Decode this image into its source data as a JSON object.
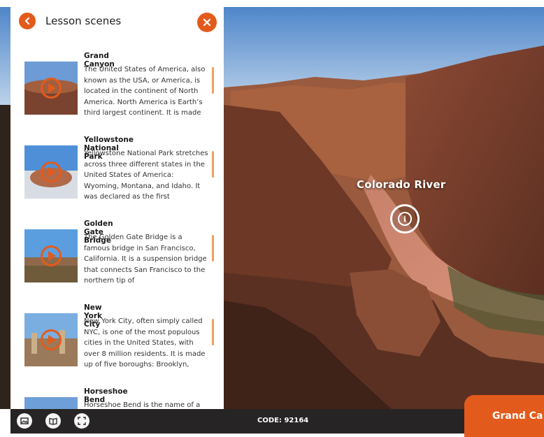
{
  "panel": {
    "title": "Lesson scenes",
    "items": [
      {
        "title": "Grand Canyon",
        "description": "The United States of America, also known as the USA, or America, is located in the continent of North America. North America is Earth’s third largest continent. It is made"
      },
      {
        "title": "Yellowstone National Park",
        "description": "Yellowstone National Park stretches across three different states in the United States of America: Wyoming, Montana, and Idaho. It was declared as the first"
      },
      {
        "title": "Golden Gate Bridge",
        "description": "The Golden Gate Bridge is a famous bridge in San Francisco, California. It is a suspension bridge that connects San Francisco to the northern tip of"
      },
      {
        "title": "New York City",
        "description": "New York City, often simply called NYC, is one of the most populous cities in the United States, with over 8 million residents. It is made up of five boroughs: Brooklyn,"
      },
      {
        "title": "Horseshoe Bend",
        "description": "Horseshoe Bend is the name of a"
      }
    ]
  },
  "hotspot": {
    "label": "Colorado River"
  },
  "bottom_bar": {
    "code": "CODE: 92164"
  },
  "scene_tab": {
    "label": "Grand Ca"
  },
  "icons": {
    "back": "chevron-left-icon",
    "close": "close-icon",
    "play": "play-icon",
    "info": "info-icon",
    "image": "image-icon",
    "book": "book-icon",
    "fullscreen": "fullscreen-icon"
  },
  "colors": {
    "accent": "#e35b1c",
    "bar": "#262424"
  }
}
